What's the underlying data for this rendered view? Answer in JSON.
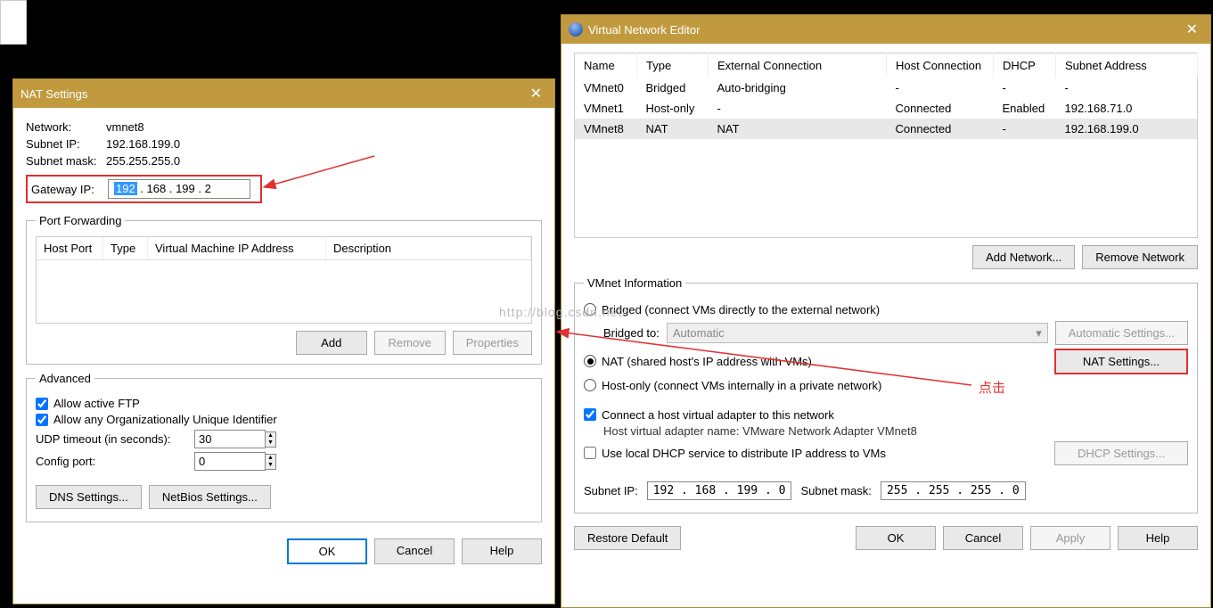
{
  "nat": {
    "title": "NAT Settings",
    "network_label": "Network:",
    "network_value": "vmnet8",
    "subnet_ip_label": "Subnet IP:",
    "subnet_ip_value": "192.168.199.0",
    "subnet_mask_label": "Subnet mask:",
    "subnet_mask_value": "255.255.255.0",
    "gateway_ip_label": "Gateway IP:",
    "gateway_sel": "192",
    "gateway_rest": " . 168 . 199  .   2",
    "portfwd": {
      "legend": "Port Forwarding",
      "cols": [
        "Host Port",
        "Type",
        "Virtual Machine IP Address",
        "Description"
      ],
      "add": "Add",
      "remove": "Remove",
      "properties": "Properties"
    },
    "adv": {
      "legend": "Advanced",
      "allow_ftp": "Allow active FTP",
      "allow_oui": "Allow any Organizationally Unique Identifier",
      "udp_label": "UDP timeout (in seconds):",
      "udp_val": "30",
      "cfg_label": "Config port:",
      "cfg_val": "0",
      "dns": "DNS Settings...",
      "netbios": "NetBios Settings..."
    },
    "ok": "OK",
    "cancel": "Cancel",
    "help": "Help"
  },
  "vne": {
    "title": "Virtual Network Editor",
    "cols": [
      "Name",
      "Type",
      "External Connection",
      "Host Connection",
      "DHCP",
      "Subnet Address"
    ],
    "rows": [
      {
        "name": "VMnet0",
        "type": "Bridged",
        "ext": "Auto-bridging",
        "host": "-",
        "dhcp": "-",
        "subnet": "-"
      },
      {
        "name": "VMnet1",
        "type": "Host-only",
        "ext": "-",
        "host": "Connected",
        "dhcp": "Enabled",
        "subnet": "192.168.71.0"
      },
      {
        "name": "VMnet8",
        "type": "NAT",
        "ext": "NAT",
        "host": "Connected",
        "dhcp": "-",
        "subnet": "192.168.199.0"
      }
    ],
    "add_net": "Add Network...",
    "remove_net": "Remove Network",
    "info_legend": "VMnet Information",
    "bridged": "Bridged (connect VMs directly to the external network)",
    "bridged_to": "Bridged to:",
    "bridged_combo": "Automatic",
    "auto_settings": "Automatic Settings...",
    "nat_radio": "NAT (shared host's IP address with VMs)",
    "nat_settings": "NAT Settings...",
    "hostonly": "Host-only (connect VMs internally in a private network)",
    "connect_adapter": "Connect a host virtual adapter to this network",
    "adapter_name_label": "Host virtual adapter name: VMware Network Adapter VMnet8",
    "use_dhcp": "Use local DHCP service to distribute IP address to VMs",
    "dhcp_settings": "DHCP Settings...",
    "subnet_ip_label": "Subnet IP:",
    "subnet_ip_value": "192 . 168 . 199  .   0",
    "subnet_mask_label": "Subnet mask:",
    "subnet_mask_value": "255 . 255 . 255  .   0",
    "restore": "Restore Default",
    "ok": "OK",
    "cancel": "Cancel",
    "apply": "Apply",
    "help": "Help"
  },
  "annotation": {
    "click": "点击"
  },
  "watermark": "http://blog.csdn.net/"
}
